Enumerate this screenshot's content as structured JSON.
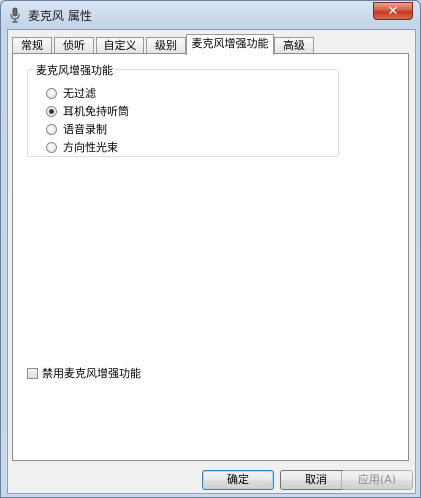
{
  "window": {
    "title": "麦克风 属性"
  },
  "tabs": [
    {
      "label": "常规"
    },
    {
      "label": "侦听"
    },
    {
      "label": "自定义"
    },
    {
      "label": "级别"
    },
    {
      "label": "麦克风增强功能",
      "active": true
    },
    {
      "label": "高级"
    }
  ],
  "enhancement": {
    "group_title": "麦克风增强功能",
    "options": [
      {
        "label": "无过滤",
        "checked": false
      },
      {
        "label": "耳机免持听筒",
        "checked": true
      },
      {
        "label": "语音录制",
        "checked": false
      },
      {
        "label": "方向性光束",
        "checked": false
      }
    ],
    "disable_checkbox": {
      "label": "禁用麦克风增强功能",
      "checked": false
    }
  },
  "buttons": {
    "ok": "确定",
    "cancel": "取消",
    "apply": "应用(A)"
  },
  "colors": {
    "window_frame": "#c6d6ea",
    "close_button": "#c33a22",
    "default_button_border": "#3c7fb1"
  },
  "icons": {
    "app": "microphone-icon",
    "close": "close-icon"
  }
}
